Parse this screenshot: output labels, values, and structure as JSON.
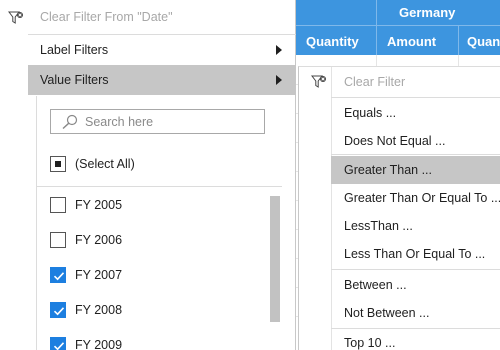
{
  "grid": {
    "country_header": "Germany",
    "columns": [
      "Quantity",
      "Amount",
      "Quantity"
    ]
  },
  "filter_popup": {
    "clear_filter_label": "Clear Filter From \"Date\"",
    "label_filters": "Label Filters",
    "value_filters": "Value Filters",
    "search_placeholder": "Search here",
    "select_all": {
      "label": "(Select All)",
      "state": "partial"
    },
    "items": [
      {
        "label": "FY 2005",
        "checked": false
      },
      {
        "label": "FY 2006",
        "checked": false
      },
      {
        "label": "FY 2007",
        "checked": true
      },
      {
        "label": "FY 2008",
        "checked": true
      },
      {
        "label": "FY 2009",
        "checked": true
      }
    ]
  },
  "value_filters_menu": {
    "clear_filter": "Clear Filter",
    "items": [
      "Equals ...",
      "Does Not Equal ...",
      "Greater Than ...",
      "Greater Than Or Equal To ...",
      "LessThan ...",
      "Less Than Or Equal To ...",
      "Between ...",
      "Not Between ...",
      "Top 10 ..."
    ],
    "highlighted": "Greater Than ..."
  },
  "colors": {
    "header_blue": "#3d95df",
    "checkbox_blue": "#1d7fe0",
    "highlight_gray": "#c6c6c6"
  },
  "icons": [
    "clear-filter-icon",
    "search-icon",
    "submenu-arrow-icon",
    "checkmark-icon"
  ]
}
